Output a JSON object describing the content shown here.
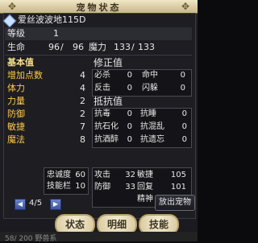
{
  "window": {
    "title": "宠物状态"
  },
  "pet": {
    "name": "爱丝波波地115D",
    "level_label": "等级",
    "level": "1"
  },
  "hp": {
    "label": "生命",
    "current": "96",
    "max": "96"
  },
  "mp": {
    "label": "魔力",
    "current": "133",
    "max": "133"
  },
  "basic": {
    "header": "基本值",
    "rows": [
      {
        "label": "增加点数",
        "value": "4"
      },
      {
        "label": "体力",
        "value": "4"
      },
      {
        "label": "力量",
        "value": "2"
      },
      {
        "label": "防御",
        "value": "2"
      },
      {
        "label": "敏捷",
        "value": "7"
      },
      {
        "label": "魔法",
        "value": "8"
      }
    ]
  },
  "mod": {
    "header": "修正值",
    "rows": [
      {
        "l1": "必杀",
        "v1": "0",
        "l2": "命中",
        "v2": "0"
      },
      {
        "l1": "反击",
        "v1": "0",
        "l2": "闪躲",
        "v2": "0"
      }
    ]
  },
  "resist": {
    "header": "抵抗值",
    "rows": [
      {
        "l1": "抗毒",
        "v1": "0",
        "l2": "抗睡",
        "v2": "0"
      },
      {
        "l1": "抗石化",
        "v1": "0",
        "l2": "抗混乱",
        "v2": "0"
      },
      {
        "l1": "抗酒醉",
        "v1": "0",
        "l2": "抗遗忘",
        "v2": "0"
      }
    ]
  },
  "stats": {
    "loyalty_label": "忠诚度",
    "loyalty": "60",
    "skill_label": "技能栏",
    "skill": "10",
    "attack_label": "攻击",
    "attack": "32",
    "defense_label": "防御",
    "defense": "33",
    "agility_label": "敏捷",
    "agility": "105",
    "recover_label": "回复",
    "recover": "101",
    "spirit_label": "精神",
    "spirit": "36"
  },
  "pager": {
    "text": "4/5"
  },
  "buttons": {
    "release": "放出宠物",
    "status": "状态",
    "detail": "明细",
    "skill": "技能"
  },
  "footer": {
    "text": "58/  200 野兽系"
  }
}
